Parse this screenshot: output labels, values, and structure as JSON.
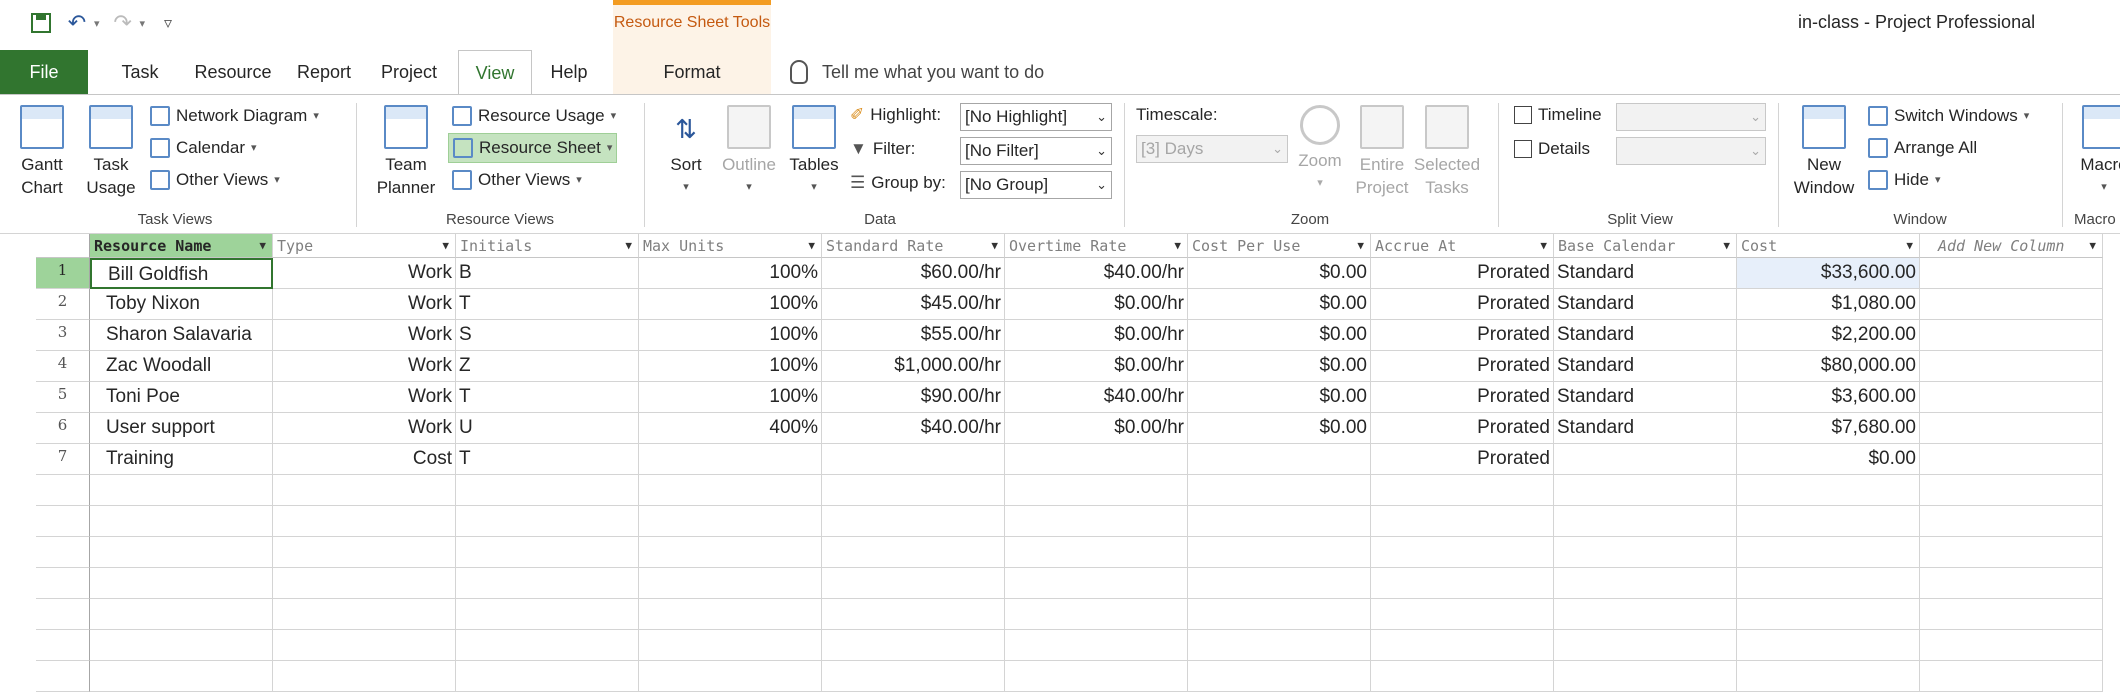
{
  "window": {
    "title": "in-class  -  Project Professional",
    "contextual_tab_group": "Resource Sheet Tools"
  },
  "tabs": [
    "File",
    "Task",
    "Resource",
    "Report",
    "Project",
    "View",
    "Help",
    "Format"
  ],
  "tell_me": "Tell me what you want to do",
  "ribbon": {
    "task_views": {
      "label": "Task Views",
      "gantt": "Gantt\nChart",
      "task_usage": "Task\nUsage",
      "network_diagram": "Network Diagram",
      "calendar": "Calendar",
      "other_views": "Other Views"
    },
    "resource_views": {
      "label": "Resource Views",
      "team_planner": "Team\nPlanner",
      "resource_usage": "Resource Usage",
      "resource_sheet": "Resource Sheet",
      "other_views": "Other Views"
    },
    "data": {
      "label": "Data",
      "sort": "Sort",
      "outline": "Outline",
      "tables": "Tables",
      "highlight_label": "Highlight:",
      "highlight_value": "[No Highlight]",
      "filter_label": "Filter:",
      "filter_value": "[No Filter]",
      "groupby_label": "Group by:",
      "groupby_value": "[No Group]"
    },
    "zoom": {
      "label": "Zoom",
      "timescale_label": "Timescale:",
      "timescale_value": "[3] Days",
      "zoom": "Zoom",
      "entire_project": "Entire\nProject",
      "selected_tasks": "Selected\nTasks"
    },
    "split_view": {
      "label": "Split View",
      "timeline": "Timeline",
      "details": "Details"
    },
    "window": {
      "label": "Window",
      "new_window": "New\nWindow",
      "switch_windows": "Switch Windows",
      "arrange_all": "Arrange All",
      "hide": "Hide"
    },
    "macros": {
      "label": "Macro",
      "macros": "Macro"
    }
  },
  "table": {
    "columns": [
      "Resource Name",
      "Type",
      "Initials",
      "Max Units",
      "Standard Rate",
      "Overtime Rate",
      "Cost Per Use",
      "Accrue At",
      "Base Calendar",
      "Cost",
      "Add New Column"
    ],
    "rows": [
      {
        "id": "1",
        "name": "Bill Goldfish",
        "type": "Work",
        "initials": "B",
        "max_units": "100%",
        "std_rate": "$60.00/hr",
        "ot_rate": "$40.00/hr",
        "cost_per_use": "$0.00",
        "accrue_at": "Prorated",
        "base_calendar": "Standard",
        "cost": "$33,600.00"
      },
      {
        "id": "2",
        "name": "Toby Nixon",
        "type": "Work",
        "initials": "T",
        "max_units": "100%",
        "std_rate": "$45.00/hr",
        "ot_rate": "$0.00/hr",
        "cost_per_use": "$0.00",
        "accrue_at": "Prorated",
        "base_calendar": "Standard",
        "cost": "$1,080.00"
      },
      {
        "id": "3",
        "name": "Sharon Salavaria",
        "type": "Work",
        "initials": "S",
        "max_units": "100%",
        "std_rate": "$55.00/hr",
        "ot_rate": "$0.00/hr",
        "cost_per_use": "$0.00",
        "accrue_at": "Prorated",
        "base_calendar": "Standard",
        "cost": "$2,200.00"
      },
      {
        "id": "4",
        "name": "Zac Woodall",
        "type": "Work",
        "initials": "Z",
        "max_units": "100%",
        "std_rate": "$1,000.00/hr",
        "ot_rate": "$0.00/hr",
        "cost_per_use": "$0.00",
        "accrue_at": "Prorated",
        "base_calendar": "Standard",
        "cost": "$80,000.00"
      },
      {
        "id": "5",
        "name": "Toni Poe",
        "type": "Work",
        "initials": "T",
        "max_units": "100%",
        "std_rate": "$90.00/hr",
        "ot_rate": "$40.00/hr",
        "cost_per_use": "$0.00",
        "accrue_at": "Prorated",
        "base_calendar": "Standard",
        "cost": "$3,600.00"
      },
      {
        "id": "6",
        "name": "User support",
        "type": "Work",
        "initials": "U",
        "max_units": "400%",
        "std_rate": "$40.00/hr",
        "ot_rate": "$0.00/hr",
        "cost_per_use": "$0.00",
        "accrue_at": "Prorated",
        "base_calendar": "Standard",
        "cost": "$7,680.00"
      },
      {
        "id": "7",
        "name": "Training",
        "type": "Cost",
        "initials": "T",
        "max_units": "",
        "std_rate": "",
        "ot_rate": "",
        "cost_per_use": "",
        "accrue_at": "Prorated",
        "base_calendar": "",
        "cost": "$0.00"
      }
    ]
  },
  "colors": {
    "accent": "#31752f",
    "selection": "#9ed39a",
    "contextual": "#f39c22"
  }
}
